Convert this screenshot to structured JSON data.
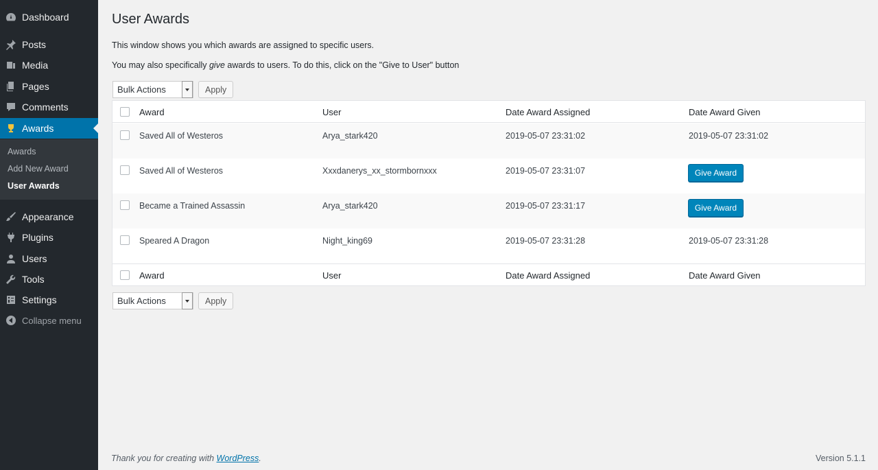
{
  "sidebar": {
    "menu": [
      {
        "label": "Dashboard",
        "icon": "dashboard-icon"
      },
      {
        "label": "Posts",
        "icon": "pin-icon"
      },
      {
        "label": "Media",
        "icon": "media-icon"
      },
      {
        "label": "Pages",
        "icon": "pages-icon"
      },
      {
        "label": "Comments",
        "icon": "comment-icon"
      },
      {
        "label": "Awards",
        "icon": "trophy-icon"
      },
      {
        "label": "Appearance",
        "icon": "paintbrush-icon"
      },
      {
        "label": "Plugins",
        "icon": "plug-icon"
      },
      {
        "label": "Users",
        "icon": "user-icon"
      },
      {
        "label": "Tools",
        "icon": "wrench-icon"
      },
      {
        "label": "Settings",
        "icon": "settings-icon"
      }
    ],
    "submenu": [
      {
        "label": "Awards"
      },
      {
        "label": "Add New Award"
      },
      {
        "label": "User Awards"
      }
    ],
    "collapse_label": "Collapse menu",
    "accent_color": "#0073aa"
  },
  "page": {
    "title": "User Awards",
    "desc1": "This window shows you which awards are assigned to specific users.",
    "desc2_before": "You may also specifically ",
    "desc2_em": "give",
    "desc2_after": " awards to users. To do this, click on the \"Give to User\" button"
  },
  "bulk": {
    "select_value": "Bulk Actions",
    "apply_label": "Apply"
  },
  "table": {
    "columns": [
      "Award",
      "User",
      "Date Award Assigned",
      "Date Award Given"
    ],
    "rows": [
      {
        "award": "Saved All of Westeros",
        "user": "Arya_stark420",
        "assigned": "2019-05-07 23:31:02",
        "given": "2019-05-07 23:31:02"
      },
      {
        "award": "Saved All of Westeros",
        "user": "Xxxdanerys_xx_stormbornxxx",
        "assigned": "2019-05-07 23:31:07",
        "given": null,
        "button": "Give Award"
      },
      {
        "award": "Became a Trained Assassin",
        "user": "Arya_stark420",
        "assigned": "2019-05-07 23:31:17",
        "given": null,
        "button": "Give Award"
      },
      {
        "award": "Speared A Dragon",
        "user": "Night_king69",
        "assigned": "2019-05-07 23:31:28",
        "given": "2019-05-07 23:31:28"
      }
    ],
    "button_color": "#0085ba"
  },
  "footer": {
    "thanks_before": "Thank you for creating with ",
    "thanks_link": "WordPress",
    "thanks_after": ".",
    "version": "Version 5.1.1"
  }
}
